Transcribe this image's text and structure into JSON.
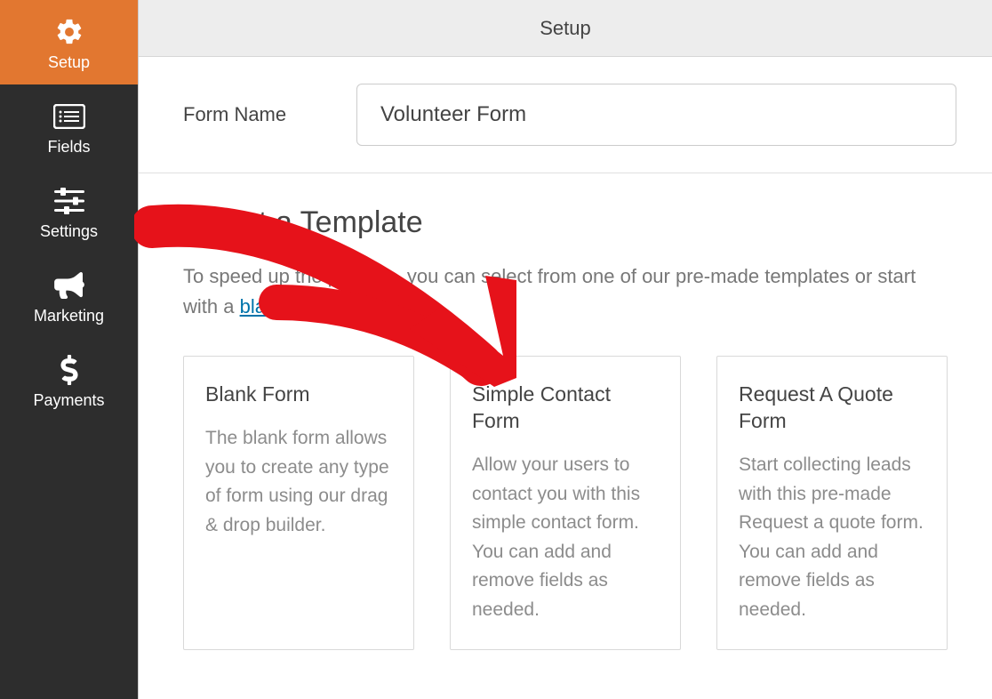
{
  "sidebar": {
    "items": [
      {
        "label": "Setup"
      },
      {
        "label": "Fields"
      },
      {
        "label": "Settings"
      },
      {
        "label": "Marketing"
      },
      {
        "label": "Payments"
      }
    ]
  },
  "topbar": {
    "title": "Setup"
  },
  "form_name": {
    "label": "Form Name",
    "value": "Volunteer Form"
  },
  "select_template": {
    "title": "Select a Template",
    "desc_prefix": "To speed up the process, you can select from one of our pre-made templates or start with a ",
    "link_text": "blank form.",
    "templates": [
      {
        "title": "Blank Form",
        "desc": "The blank form allows you to create any type of form using our drag & drop builder."
      },
      {
        "title": "Simple Contact Form",
        "desc": "Allow your users to contact you with this simple contact form. You can add and remove fields as needed."
      },
      {
        "title": "Request A Quote Form",
        "desc": "Start collecting leads with this pre-made Request a quote form. You can add and remove fields as needed."
      }
    ]
  }
}
